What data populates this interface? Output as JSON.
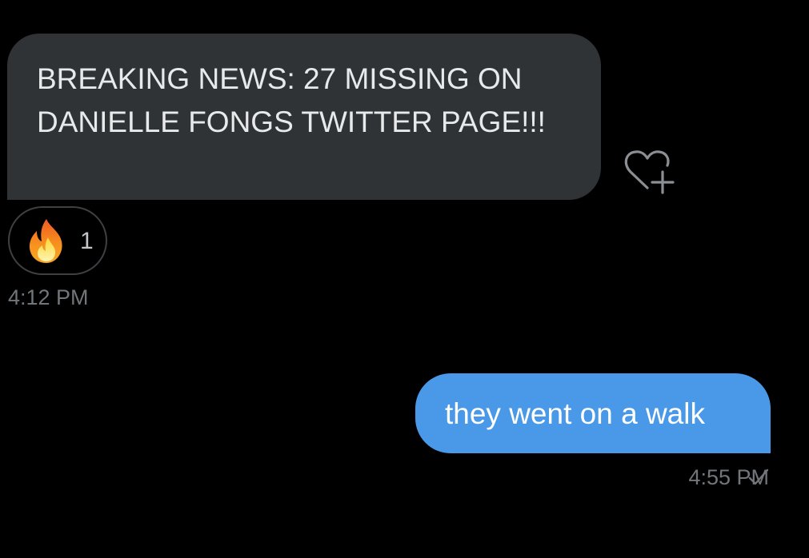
{
  "messages": {
    "incoming": {
      "text": "BREAKING NEWS: 27 MISSING ON DANIELLE FONGS TWITTER PAGE!!!",
      "reaction": {
        "emoji": "fire-emoji",
        "count": "1"
      },
      "time": "4:12 PM",
      "react_icon": "heart-plus-icon"
    },
    "outgoing": {
      "text": "they went on a walk",
      "time": "4:55 PM",
      "status_icon": "checkmark-icon"
    }
  },
  "colors": {
    "background": "#000000",
    "incoming_bubble": "#2f3336",
    "outgoing_bubble": "#4a99e9",
    "muted_text": "#71767b"
  }
}
